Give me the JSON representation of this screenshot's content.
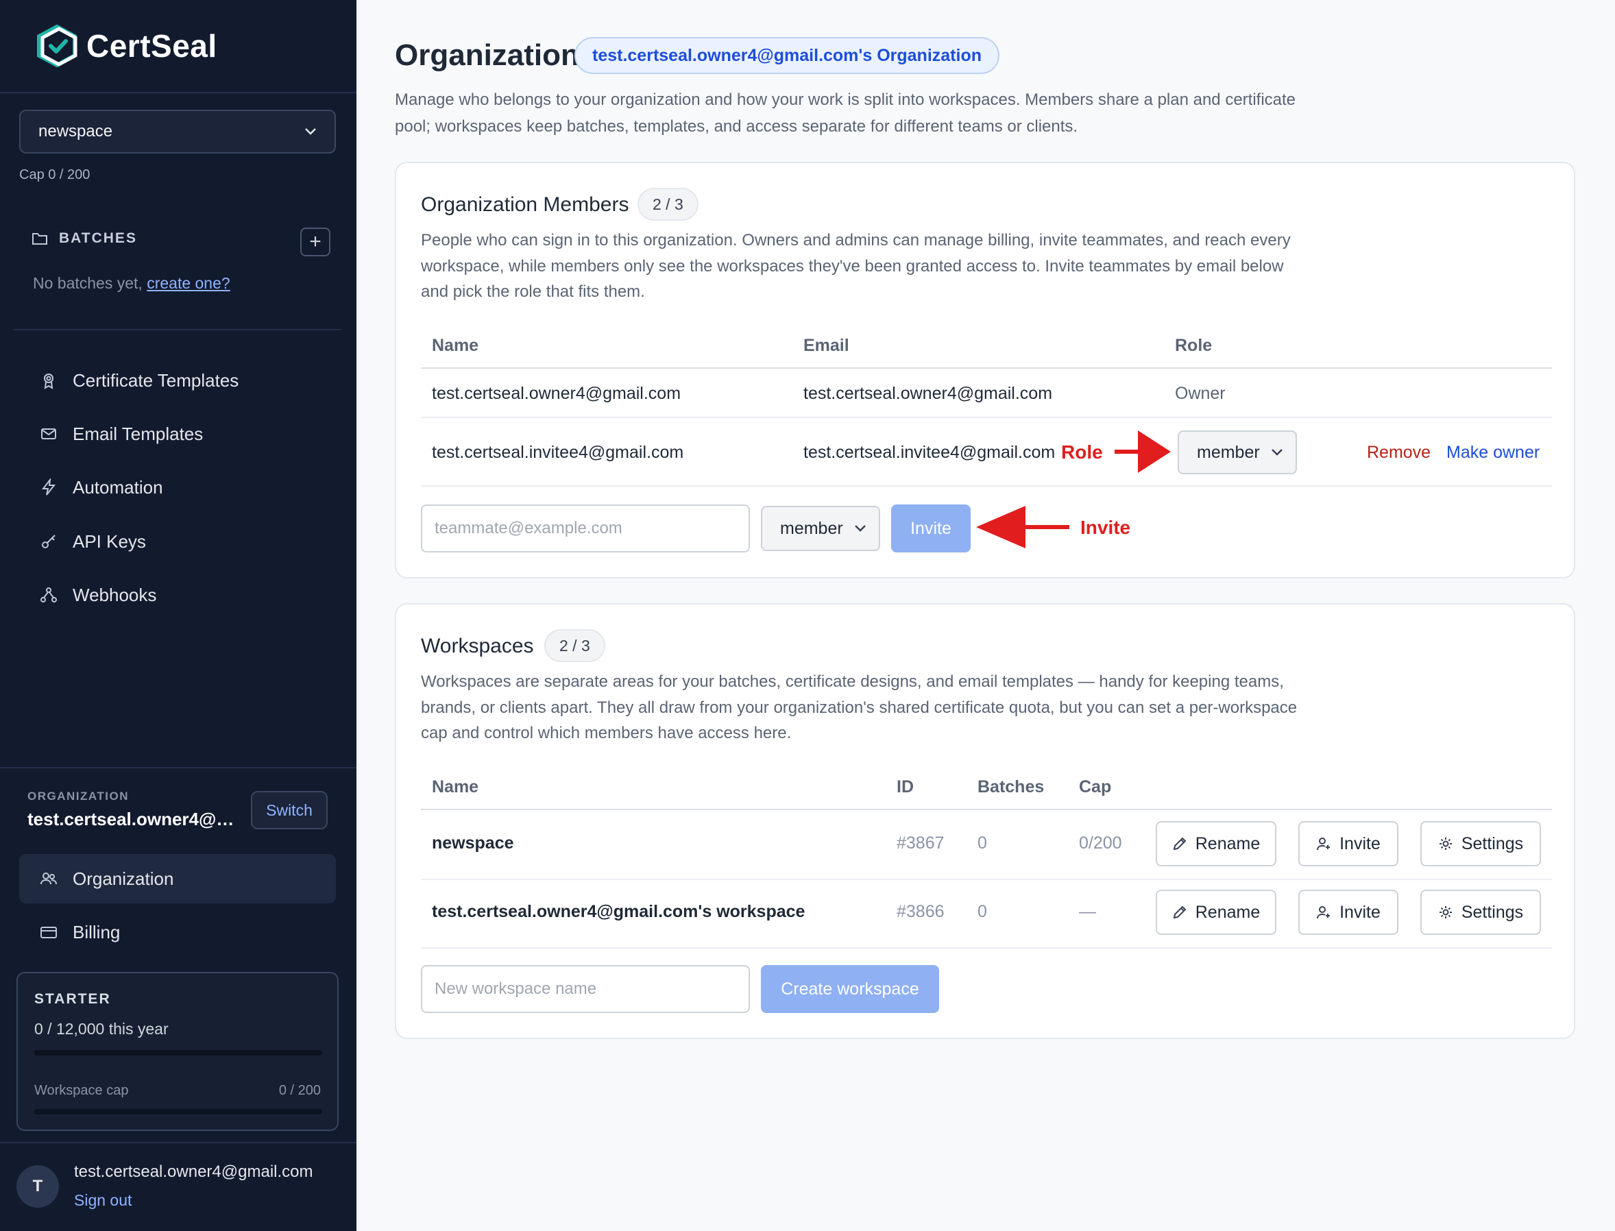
{
  "app": {
    "name": "CertSeal"
  },
  "sidebar": {
    "workspace_select": "newspace",
    "cap": "Cap 0 / 200",
    "batches": {
      "heading": "BATCHES",
      "empty_text": "No batches yet, ",
      "empty_link": "create one?"
    },
    "nav": [
      {
        "label": "Certificate Templates",
        "icon": "certificate-icon"
      },
      {
        "label": "Email Templates",
        "icon": "mail-icon"
      },
      {
        "label": "Automation",
        "icon": "lightning-icon"
      },
      {
        "label": "API Keys",
        "icon": "key-icon"
      },
      {
        "label": "Webhooks",
        "icon": "webhook-icon"
      }
    ],
    "organization": {
      "label": "ORGANIZATION",
      "name": "test.certseal.owner4@g...",
      "switch_label": "Switch"
    },
    "org_nav": [
      {
        "label": "Organization",
        "icon": "users-icon",
        "active": true
      },
      {
        "label": "Billing",
        "icon": "credit-card-icon",
        "active": false
      }
    ],
    "plan": {
      "name": "STARTER",
      "usage": "0 / 12,000 this year",
      "usage_fraction": 0,
      "cap_label": "Workspace cap",
      "cap_value": "0 / 200",
      "cap_fraction": 0
    },
    "user": {
      "initial": "T",
      "email": "test.certseal.owner4@gmail.com",
      "sign_out": "Sign out"
    }
  },
  "page": {
    "title": "Organization",
    "org_badge": "test.certseal.owner4@gmail.com's Organization",
    "description": "Manage who belongs to your organization and how your work is split into workspaces. Members share a plan and certificate pool; workspaces keep batches, templates, and access separate for different teams or clients."
  },
  "members": {
    "title": "Organization Members",
    "count": "2 / 3",
    "description": "People who can sign in to this organization. Owners and admins can manage billing, invite teammates, and reach every workspace, while members only see the workspaces they've been granted access to. Invite teammates by email below and pick the role that fits them.",
    "columns": [
      "Name",
      "Email",
      "Role"
    ],
    "rows": [
      {
        "name": "test.certseal.owner4@gmail.com",
        "email": "test.certseal.owner4@gmail.com",
        "role": "Owner"
      },
      {
        "name": "test.certseal.invitee4@gmail.com",
        "email": "test.certseal.invitee4@gmail.com",
        "role": "member",
        "remove": "Remove",
        "make_owner": "Make owner"
      }
    ],
    "invite": {
      "placeholder": "teammate@example.com",
      "role": "member",
      "button": "Invite"
    }
  },
  "annotations": {
    "role": "Role",
    "invite": "Invite",
    "color": "#e11d1d"
  },
  "workspaces": {
    "title": "Workspaces",
    "count": "2 / 3",
    "description": "Workspaces are separate areas for your batches, certificate designs, and email templates — handy for keeping teams, brands, or clients apart. They all draw from your organization's shared certificate quota, but you can set a per-workspace cap and control which members have access here.",
    "columns": [
      "Name",
      "ID",
      "Batches",
      "Cap"
    ],
    "rows": [
      {
        "name": "newspace",
        "id": "#3867",
        "batches": "0",
        "cap": "0/200"
      },
      {
        "name": "test.certseal.owner4@gmail.com's workspace",
        "id": "#3866",
        "batches": "0",
        "cap": "—"
      }
    ],
    "actions": {
      "rename": "Rename",
      "invite": "Invite",
      "settings": "Settings"
    },
    "new_placeholder": "New workspace name",
    "create_button": "Create workspace"
  }
}
